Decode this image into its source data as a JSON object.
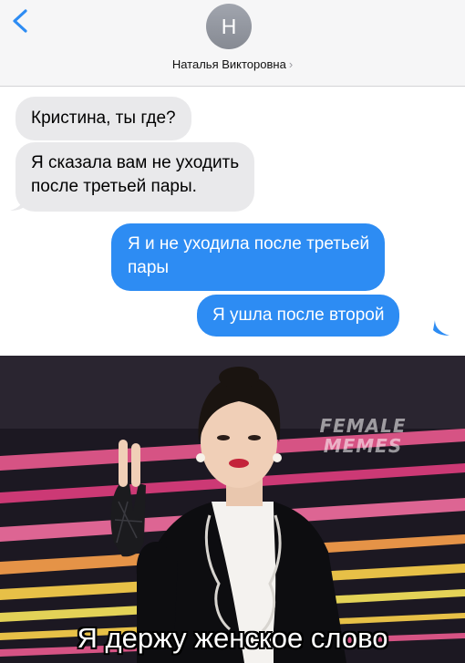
{
  "header": {
    "avatar_initial": "Н",
    "contact_name": "Наталья Викторовна",
    "chevron": "›",
    "back_icon": "chevron-left-icon",
    "accent_color": "#2d8cf3"
  },
  "messages": [
    {
      "direction": "incoming",
      "lines": [
        "Кристина, ты где?"
      ]
    },
    {
      "direction": "incoming",
      "lines": [
        "Я сказала вам не уходить",
        "после третьей пары."
      ]
    },
    {
      "direction": "outgoing",
      "lines": [
        "Я и не уходила после третьей",
        "пары"
      ]
    },
    {
      "direction": "outgoing",
      "lines": [
        "Я ушла после второй"
      ]
    }
  ],
  "meme": {
    "watermark_line1": "FEMALE",
    "watermark_line2": "MEMES",
    "caption": "Я держу женское слово"
  },
  "colors": {
    "incoming_bubble": "#e9e9eb",
    "outgoing_bubble": "#2d8cf3",
    "header_bg": "#f6f6f7"
  }
}
